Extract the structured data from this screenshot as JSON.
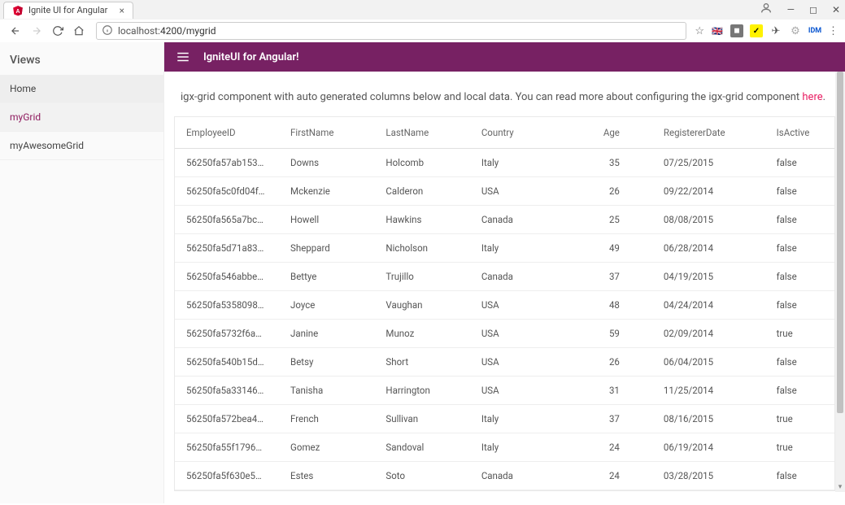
{
  "browser": {
    "tab_title": "Ignite UI for Angular",
    "url_host": "localhost:",
    "url_port_path": "4200/mygrid"
  },
  "sidebar": {
    "title": "Views",
    "items": [
      {
        "label": "Home",
        "active": false,
        "home": true
      },
      {
        "label": "myGrid",
        "active": true,
        "home": false
      },
      {
        "label": "myAwesomeGrid",
        "active": false,
        "home": false
      }
    ]
  },
  "appbar": {
    "title": "IgniteUI for Angular!"
  },
  "intro": {
    "text": "igx-grid component with auto generated columns below and local data. You can read more about configuring the igx-grid component ",
    "link_label": "here",
    "suffix": "."
  },
  "grid": {
    "columns": [
      "EmployeeID",
      "FirstName",
      "LastName",
      "Country",
      "Age",
      "RegistererDate",
      "IsActive"
    ],
    "rows": [
      {
        "EmployeeID": "56250fa57ab153…",
        "FirstName": "Downs",
        "LastName": "Holcomb",
        "Country": "Italy",
        "Age": "35",
        "RegistererDate": "07/25/2015",
        "IsActive": "false"
      },
      {
        "EmployeeID": "56250fa5c0fd04f…",
        "FirstName": "Mckenzie",
        "LastName": "Calderon",
        "Country": "USA",
        "Age": "26",
        "RegistererDate": "09/22/2014",
        "IsActive": "false"
      },
      {
        "EmployeeID": "56250fa565a7bc…",
        "FirstName": "Howell",
        "LastName": "Hawkins",
        "Country": "Canada",
        "Age": "25",
        "RegistererDate": "08/08/2015",
        "IsActive": "false"
      },
      {
        "EmployeeID": "56250fa5d71a83…",
        "FirstName": "Sheppard",
        "LastName": "Nicholson",
        "Country": "Italy",
        "Age": "49",
        "RegistererDate": "06/28/2014",
        "IsActive": "false"
      },
      {
        "EmployeeID": "56250fa546abbe…",
        "FirstName": "Bettye",
        "LastName": "Trujillo",
        "Country": "Canada",
        "Age": "37",
        "RegistererDate": "04/19/2015",
        "IsActive": "false"
      },
      {
        "EmployeeID": "56250fa5358098…",
        "FirstName": "Joyce",
        "LastName": "Vaughan",
        "Country": "USA",
        "Age": "48",
        "RegistererDate": "04/24/2014",
        "IsActive": "false"
      },
      {
        "EmployeeID": "56250fa5732f6a…",
        "FirstName": "Janine",
        "LastName": "Munoz",
        "Country": "USA",
        "Age": "59",
        "RegistererDate": "02/09/2014",
        "IsActive": "true"
      },
      {
        "EmployeeID": "56250fa540b15d…",
        "FirstName": "Betsy",
        "LastName": "Short",
        "Country": "USA",
        "Age": "26",
        "RegistererDate": "06/04/2015",
        "IsActive": "false"
      },
      {
        "EmployeeID": "56250fa5a33146…",
        "FirstName": "Tanisha",
        "LastName": "Harrington",
        "Country": "USA",
        "Age": "31",
        "RegistererDate": "11/25/2014",
        "IsActive": "false"
      },
      {
        "EmployeeID": "56250fa572bea4…",
        "FirstName": "French",
        "LastName": "Sullivan",
        "Country": "Italy",
        "Age": "37",
        "RegistererDate": "08/16/2015",
        "IsActive": "true"
      },
      {
        "EmployeeID": "56250fa55f1796…",
        "FirstName": "Gomez",
        "LastName": "Sandoval",
        "Country": "Italy",
        "Age": "24",
        "RegistererDate": "06/19/2014",
        "IsActive": "true"
      },
      {
        "EmployeeID": "56250fa5f630e5…",
        "FirstName": "Estes",
        "LastName": "Soto",
        "Country": "Canada",
        "Age": "24",
        "RegistererDate": "03/28/2015",
        "IsActive": "false"
      }
    ]
  }
}
